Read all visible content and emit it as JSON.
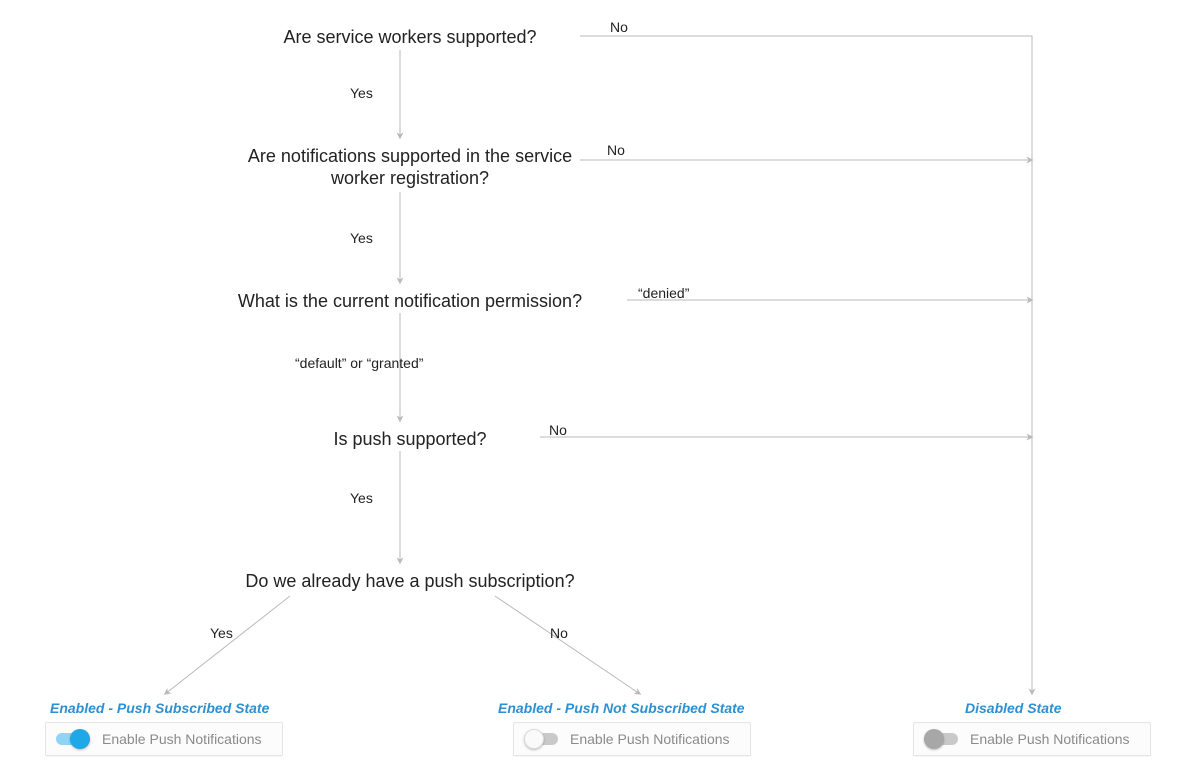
{
  "questions": {
    "q1": "Are service workers supported?",
    "q2": "Are notifications supported in the service worker registration?",
    "q3": "What is the current notification permission?",
    "q4": "Is push supported?",
    "q5": "Do we already have a push subscription?"
  },
  "edges": {
    "q1_yes": "Yes",
    "q1_no": "No",
    "q2_yes": "Yes",
    "q2_no": "No",
    "q3_yes": "“default” or “granted”",
    "q3_no": "“denied”",
    "q4_yes": "Yes",
    "q4_no": "No",
    "q5_yes": "Yes",
    "q5_no": "No"
  },
  "states": {
    "subscribed": {
      "title": "Enabled - Push Subscribed State",
      "toggle_label": "Enable Push Notifications",
      "style": "on"
    },
    "unsubscribed": {
      "title": "Enabled - Push Not Subscribed State",
      "toggle_label": "Enable Push Notifications",
      "style": "off"
    },
    "disabled": {
      "title": "Disabled State",
      "toggle_label": "Enable Push Notifications",
      "style": "disabled"
    }
  },
  "colors": {
    "accent": "#1ea8e8",
    "link": "#2e90d0",
    "muted": "#8a8a8a",
    "line": "#b9b9b9"
  }
}
